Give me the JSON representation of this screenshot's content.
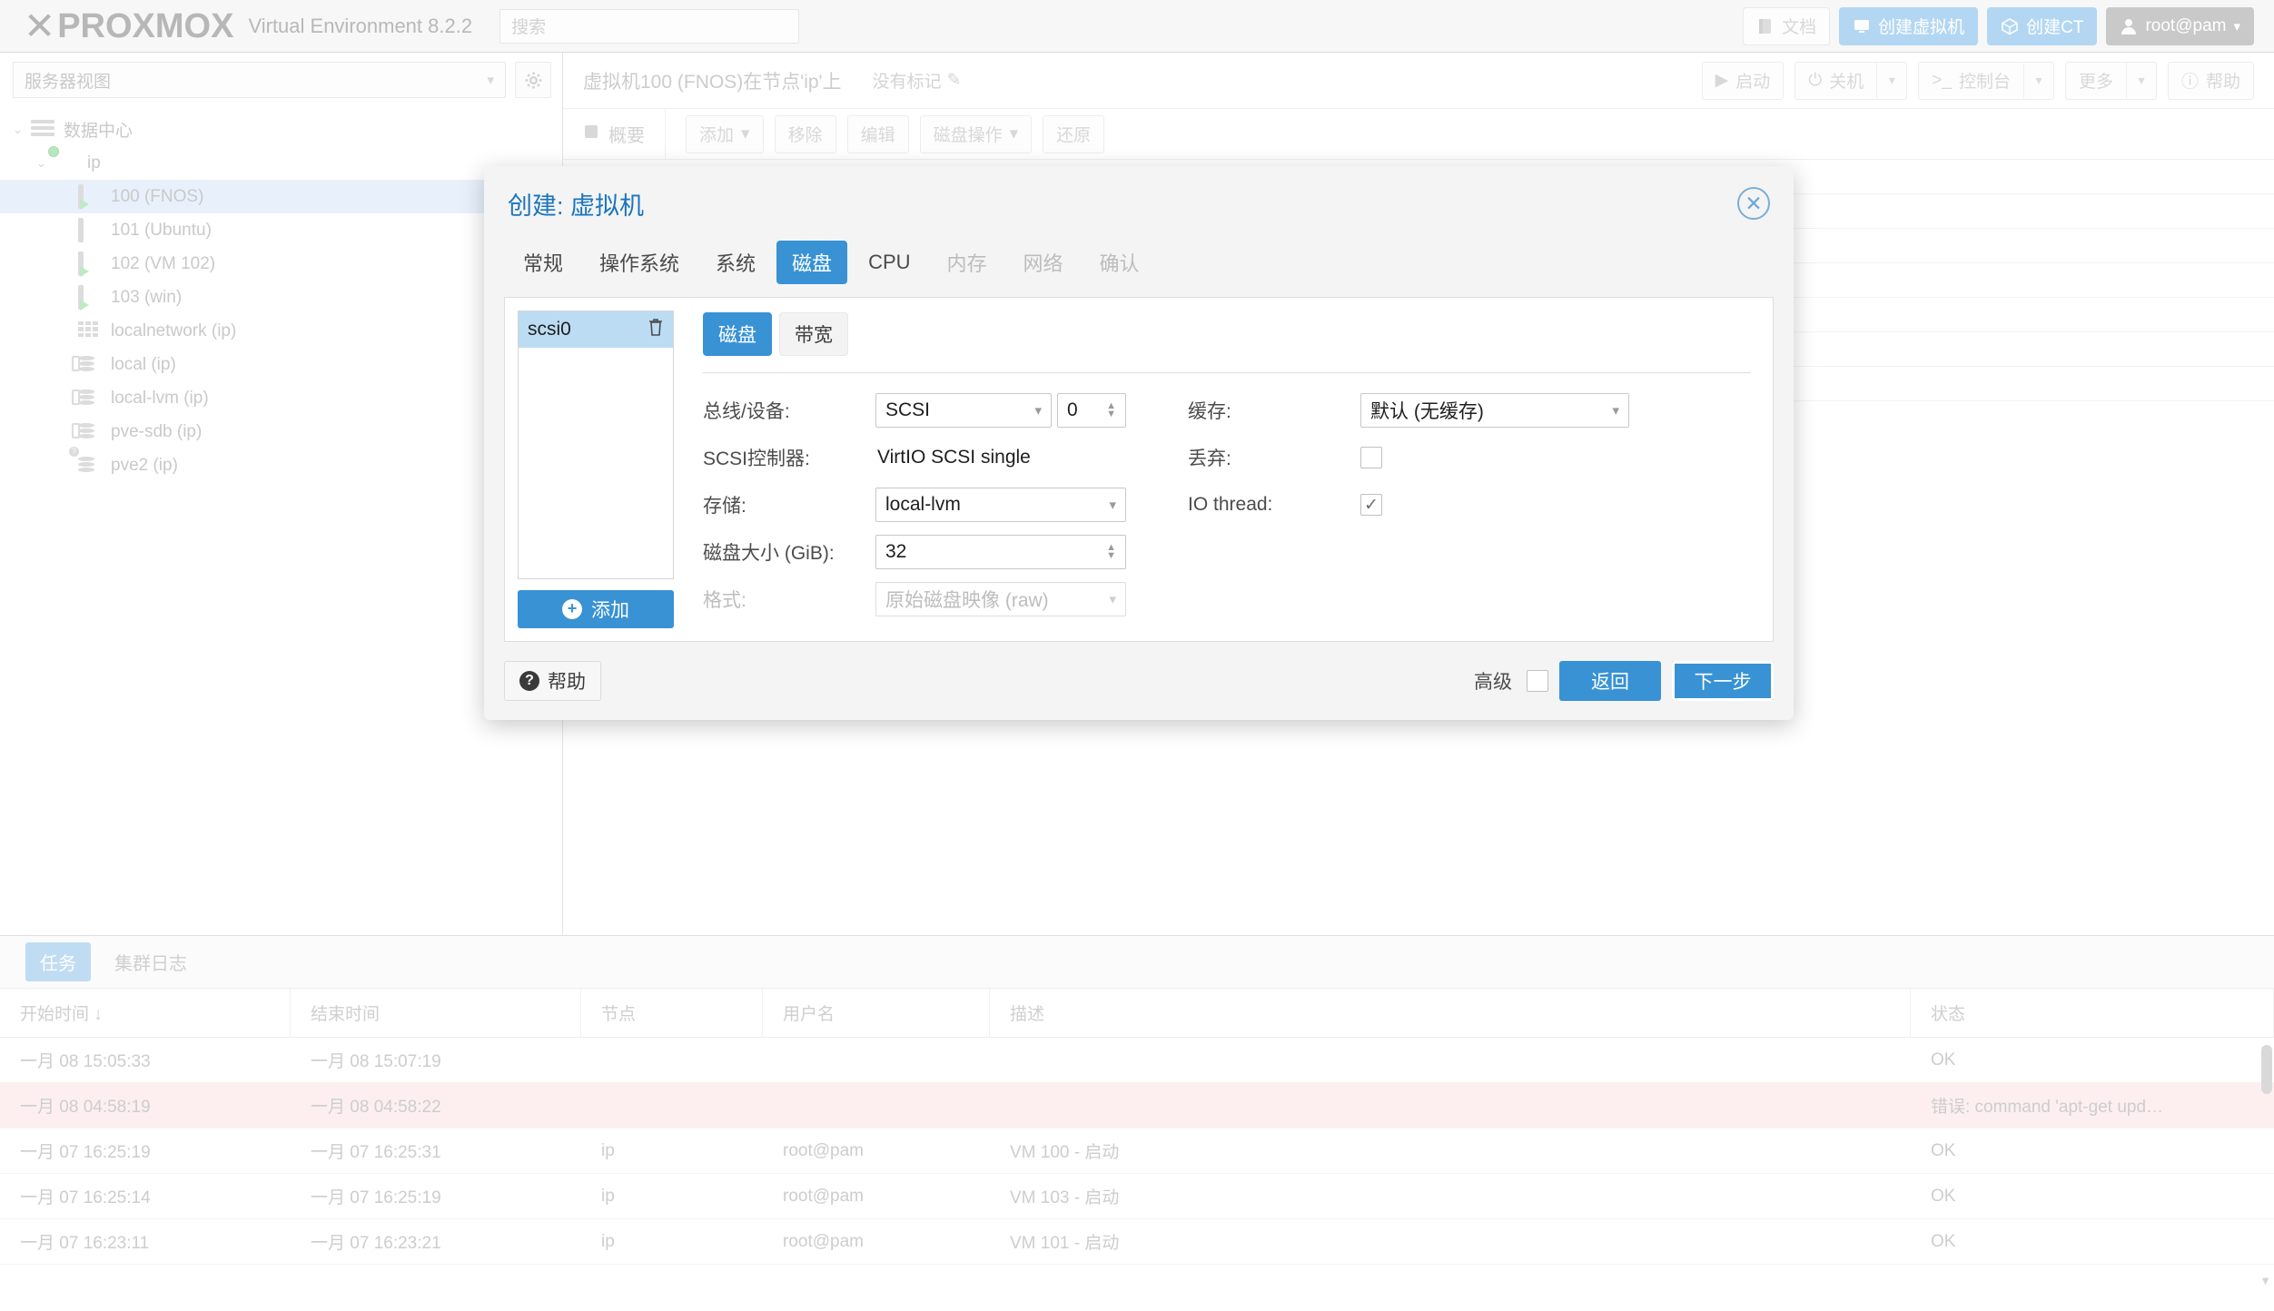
{
  "header": {
    "logo_x": "X",
    "logo_word": "PROXMOX",
    "product": "Virtual Environment 8.2.2",
    "search_placeholder": "搜索",
    "buttons": [
      {
        "label": "文档",
        "icon": "book-icon",
        "style": "plain"
      },
      {
        "label": "创建虚拟机",
        "icon": "monitor-icon",
        "style": "blue"
      },
      {
        "label": "创建CT",
        "icon": "cube-icon",
        "style": "blue"
      },
      {
        "label": "root@pam",
        "icon": "user-icon",
        "style": "user"
      }
    ]
  },
  "sidebar": {
    "view_selector": "服务器视图",
    "gear_icon": "gear-icon",
    "tree": [
      {
        "label": "数据中心",
        "icon": "datacenter-icon",
        "indent": 0,
        "expanded": true,
        "selected": false
      },
      {
        "label": "ip",
        "icon": "node-icon",
        "indent": 1,
        "expanded": true,
        "selected": false
      },
      {
        "label": "100 (FNOS)",
        "icon": "vm-running-icon",
        "indent": 2,
        "expanded": null,
        "selected": true
      },
      {
        "label": "101 (Ubuntu)",
        "icon": "vm-stopped-icon",
        "indent": 2,
        "expanded": null,
        "selected": false
      },
      {
        "label": "102 (VM 102)",
        "icon": "vm-running-icon",
        "indent": 2,
        "expanded": null,
        "selected": false
      },
      {
        "label": "103 (win)",
        "icon": "vm-running-icon",
        "indent": 2,
        "expanded": null,
        "selected": false
      },
      {
        "label": "localnetwork (ip)",
        "icon": "network-icon",
        "indent": 2,
        "expanded": null,
        "selected": false
      },
      {
        "label": "local (ip)",
        "icon": "storage-icon",
        "indent": 2,
        "expanded": null,
        "selected": false
      },
      {
        "label": "local-lvm (ip)",
        "icon": "storage-icon",
        "indent": 2,
        "expanded": null,
        "selected": false
      },
      {
        "label": "pve-sdb (ip)",
        "icon": "storage-icon",
        "indent": 2,
        "expanded": null,
        "selected": false
      },
      {
        "label": "pve2 (ip)",
        "icon": "storage-unknown-icon",
        "indent": 2,
        "expanded": null,
        "selected": false
      }
    ]
  },
  "vm_header": {
    "title": "虚拟机100 (FNOS)在节点'ip'上",
    "tag_label": "没有标记",
    "tag_edit_icon": "pencil-icon",
    "actions": [
      {
        "label": "启动",
        "icon": "play-icon",
        "split": false
      },
      {
        "label": "关机",
        "icon": "power-icon",
        "split": true
      },
      {
        "label": "控制台",
        "icon": "terminal-icon",
        "split": true
      },
      {
        "label": "更多",
        "icon": "",
        "split": true
      },
      {
        "label": "帮助",
        "icon": "help-icon",
        "split": false
      }
    ],
    "tab": {
      "label": "概要",
      "icon": "summary-icon"
    },
    "toolbar2": [
      "添加",
      "移除",
      "编辑",
      "磁盘操作",
      "还原"
    ]
  },
  "tasks_panel": {
    "tabs": [
      {
        "label": "任务",
        "active": true
      },
      {
        "label": "集群日志",
        "active": false
      }
    ],
    "columns": [
      "开始时间 ↓",
      "结束时间",
      "节点",
      "用户名",
      "描述",
      "状态"
    ],
    "rows": [
      {
        "start": "一月 08 15:05:33",
        "end": "一月 08 15:07:19",
        "node": "",
        "user": "",
        "desc": "",
        "status": "OK",
        "error": false
      },
      {
        "start": "一月 08 04:58:19",
        "end": "一月 08 04:58:22",
        "node": "",
        "user": "",
        "desc": "",
        "status": "错误: command 'apt-get upd…",
        "error": true
      },
      {
        "start": "一月 07 16:25:19",
        "end": "一月 07 16:25:31",
        "node": "ip",
        "user": "root@pam",
        "desc": "VM 100 - 启动",
        "status": "OK",
        "error": false
      },
      {
        "start": "一月 07 16:25:14",
        "end": "一月 07 16:25:19",
        "node": "ip",
        "user": "root@pam",
        "desc": "VM 103 - 启动",
        "status": "OK",
        "error": false
      },
      {
        "start": "一月 07 16:23:11",
        "end": "一月 07 16:23:21",
        "node": "ip",
        "user": "root@pam",
        "desc": "VM 101 - 启动",
        "status": "OK",
        "error": false
      }
    ]
  },
  "modal": {
    "title": "创建: 虚拟机",
    "close_icon": "close-circle-icon",
    "tabs": [
      {
        "label": "常规",
        "state": "normal"
      },
      {
        "label": "操作系统",
        "state": "normal"
      },
      {
        "label": "系统",
        "state": "normal"
      },
      {
        "label": "磁盘",
        "state": "active"
      },
      {
        "label": "CPU",
        "state": "normal"
      },
      {
        "label": "内存",
        "state": "disabled"
      },
      {
        "label": "网络",
        "state": "disabled"
      },
      {
        "label": "确认",
        "state": "disabled"
      }
    ],
    "disk_list": [
      {
        "name": "scsi0",
        "delete_icon": "trash-icon",
        "selected": true
      }
    ],
    "add_button": {
      "label": "添加",
      "icon": "plus-circle-icon"
    },
    "sub_tabs": [
      {
        "label": "磁盘",
        "active": true
      },
      {
        "label": "带宽",
        "active": false
      }
    ],
    "form": {
      "bus_device": {
        "label": "总线/设备:",
        "bus_value": "SCSI",
        "device_value": "0"
      },
      "scsi_controller": {
        "label": "SCSI控制器:",
        "value": "VirtIO SCSI single"
      },
      "storage": {
        "label": "存储:",
        "value": "local-lvm"
      },
      "disk_size": {
        "label": "磁盘大小 (GiB):",
        "value": "32"
      },
      "format": {
        "label": "格式:",
        "value": "原始磁盘映像 (raw)",
        "disabled": true
      },
      "cache": {
        "label": "缓存:",
        "value": "默认 (无缓存)"
      },
      "discard": {
        "label": "丢弃:",
        "checked": false
      },
      "io_thread": {
        "label": "IO thread:",
        "checked": true,
        "check_glyph": "✓"
      }
    },
    "footer": {
      "help_label": "帮助",
      "help_icon": "question-icon",
      "advanced_label": "高级",
      "advanced_checked": false,
      "back_label": "返回",
      "next_label": "下一步"
    }
  },
  "colors": {
    "accent": "#3892d4",
    "title_blue": "#1a75bc",
    "selection": "#bcdcf3",
    "error_bg": "#fdeff0"
  }
}
